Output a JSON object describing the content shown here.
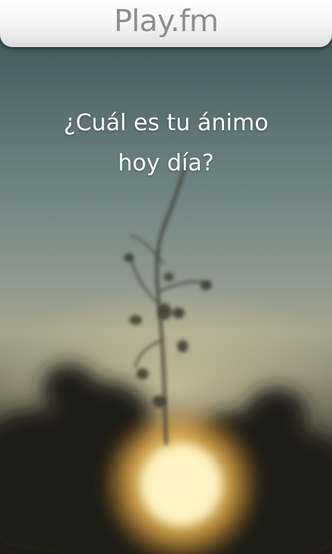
{
  "header": {
    "title": "Play.fm"
  },
  "main": {
    "question_line1": "¿Cuál es tu ánimo",
    "question_line2": "hoy día?"
  },
  "colors": {
    "title_text": "#8e8e8e",
    "title_bar": "#f4f4f4",
    "question_text": "#ffffff",
    "sun_glow": "#ffe48a"
  }
}
